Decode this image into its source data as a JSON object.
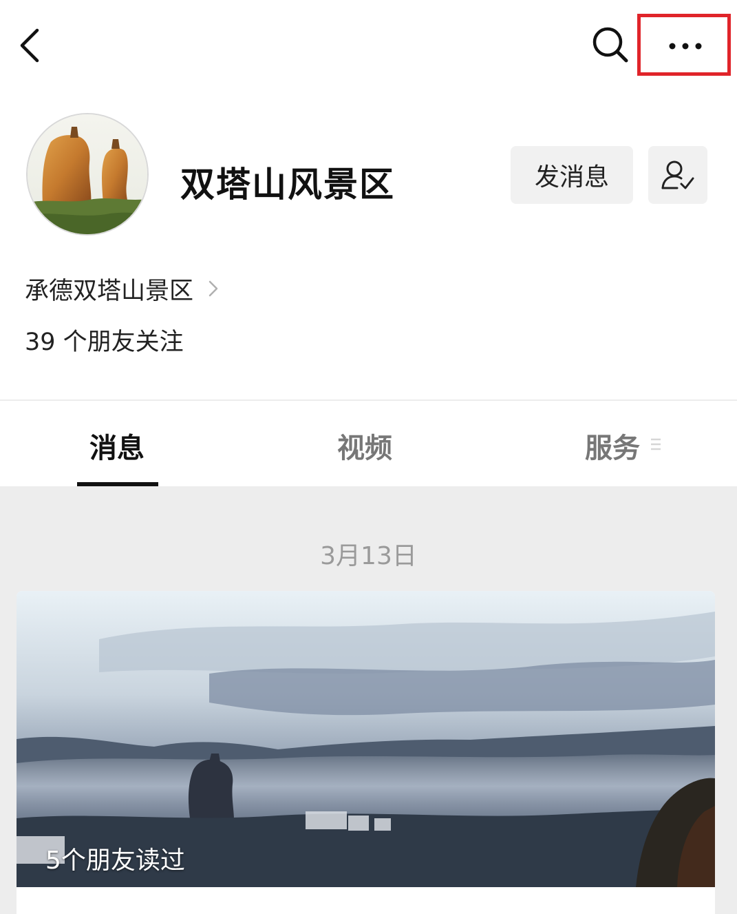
{
  "topbar": {
    "back_icon": "chevron-left-icon",
    "search_icon": "search-icon",
    "more_icon": "more-horizontal-icon",
    "highlight_color": "#e0242a"
  },
  "profile": {
    "name": "双塔山风景区",
    "send_message_label": "发消息",
    "follow_icon": "user-check-icon"
  },
  "entity": {
    "label": "承德双塔山景区",
    "chevron_icon": "chevron-right-icon"
  },
  "friends_following": "39 个朋友关注",
  "tabs": [
    {
      "label": "消息",
      "active": true
    },
    {
      "label": "视频",
      "active": false
    },
    {
      "label": "服务",
      "active": false
    }
  ],
  "feed": {
    "date": "3月13日",
    "article": {
      "read_by_friends": "5个朋友读过"
    }
  }
}
